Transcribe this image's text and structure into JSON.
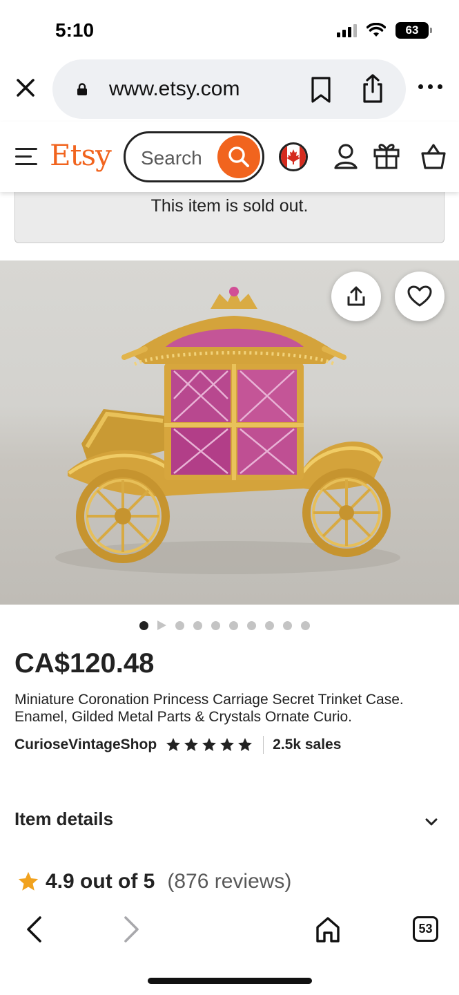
{
  "status_bar": {
    "time": "5:10",
    "battery": "63"
  },
  "browser": {
    "url": "www.etsy.com",
    "tabs_count": "53"
  },
  "header": {
    "logo": "Etsy",
    "search_placeholder": "Search",
    "brand_color": "#f1641e"
  },
  "notice": {
    "text": "This item is sold out."
  },
  "carousel": {
    "total_dots": 10,
    "active_index": 0
  },
  "product": {
    "price": "CA$120.48",
    "title": "Miniature Coronation Princess Carriage Secret Trinket Case. Enamel, Gilded Metal Parts & Crystals Ornate Curio.",
    "shop": "CurioseVintageShop",
    "stars": 5,
    "sales": "2.5k sales"
  },
  "sections": {
    "item_details": "Item details"
  },
  "reviews": {
    "rating": "4.9 out of 5",
    "count": "(876 reviews)",
    "star_color": "#f1a21e"
  },
  "icons": [
    "close-icon",
    "lock-icon",
    "bookmark-icon",
    "share-icon",
    "more-icon",
    "menu-icon",
    "search-icon",
    "canada-flag-icon",
    "user-icon",
    "gift-icon",
    "cart-icon",
    "heart-icon",
    "chevron-down-icon",
    "back-icon",
    "forward-icon",
    "home-icon",
    "tabs-icon"
  ]
}
